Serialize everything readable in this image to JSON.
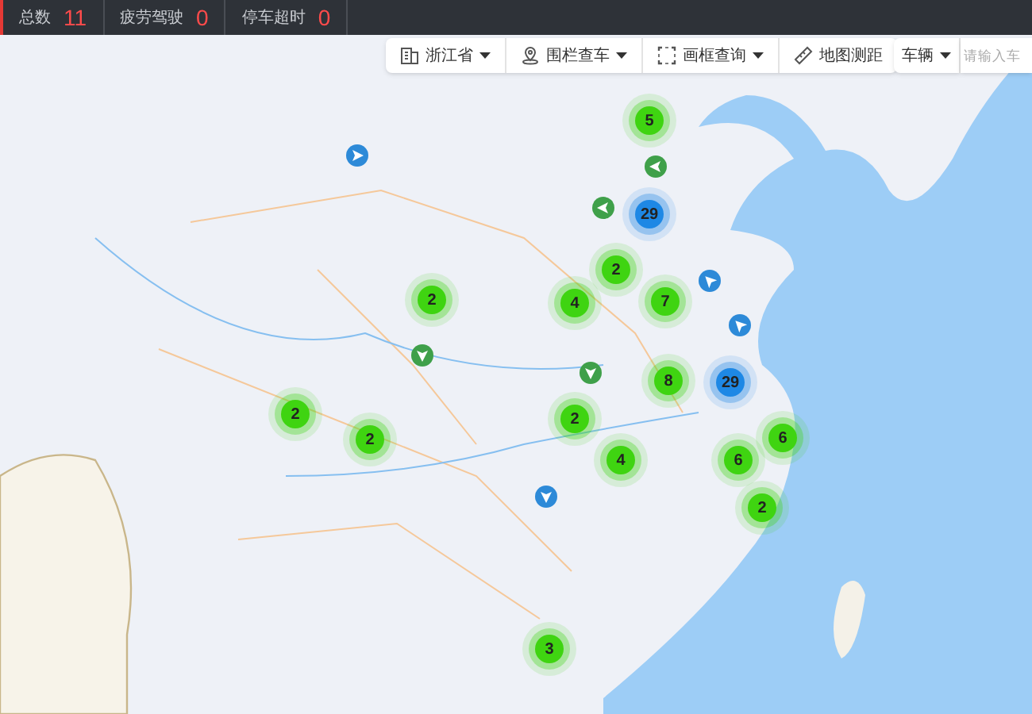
{
  "status_bar": [
    {
      "label": "总数",
      "value": "11"
    },
    {
      "label": "疲劳驾驶",
      "value": "0"
    },
    {
      "label": "停车超时",
      "value": "0"
    }
  ],
  "toolbar": [
    {
      "kind": "region",
      "label": "浙江省",
      "dropdown": true
    },
    {
      "kind": "fence",
      "label": "围栏查车",
      "dropdown": true
    },
    {
      "kind": "frame",
      "label": "画框查询",
      "dropdown": true
    },
    {
      "kind": "ruler",
      "label": "地图测距",
      "dropdown": false
    }
  ],
  "search": {
    "type_label": "车辆",
    "placeholder": "请输入车"
  },
  "markers": [
    {
      "kind": "cluster",
      "count": "5",
      "color": "#3fd411"
    },
    {
      "kind": "vehicle",
      "color": "#2d8ad8"
    },
    {
      "kind": "vehicle",
      "color": "#3fa04a"
    },
    {
      "kind": "vehicle",
      "color": "#3fa04a"
    },
    {
      "kind": "cluster",
      "count": "29",
      "color": "#1e88e5"
    },
    {
      "kind": "cluster",
      "count": "2",
      "color": "#3fd411"
    },
    {
      "kind": "vehicle",
      "color": "#2d8ad8"
    },
    {
      "kind": "cluster",
      "count": "2",
      "color": "#3fd411"
    },
    {
      "kind": "cluster",
      "count": "4",
      "color": "#3fd411"
    },
    {
      "kind": "cluster",
      "count": "7",
      "color": "#3fd411"
    },
    {
      "kind": "vehicle",
      "color": "#2d8ad8"
    },
    {
      "kind": "vehicle",
      "color": "#3fa04a"
    },
    {
      "kind": "vehicle",
      "color": "#3fa04a"
    },
    {
      "kind": "cluster",
      "count": "8",
      "color": "#3fd411"
    },
    {
      "kind": "cluster",
      "count": "29",
      "color": "#1e88e5"
    },
    {
      "kind": "cluster",
      "count": "2",
      "color": "#3fd411"
    },
    {
      "kind": "cluster",
      "count": "2",
      "color": "#3fd411"
    },
    {
      "kind": "cluster",
      "count": "2",
      "color": "#3fd411"
    },
    {
      "kind": "cluster",
      "count": "6",
      "color": "#3fd411"
    },
    {
      "kind": "cluster",
      "count": "4",
      "color": "#3fd411"
    },
    {
      "kind": "cluster",
      "count": "6",
      "color": "#3fd411"
    },
    {
      "kind": "vehicle",
      "color": "#2d8ad8"
    },
    {
      "kind": "cluster",
      "count": "2",
      "color": "#3fd411"
    },
    {
      "kind": "cluster",
      "count": "3",
      "color": "#3fd411"
    }
  ]
}
